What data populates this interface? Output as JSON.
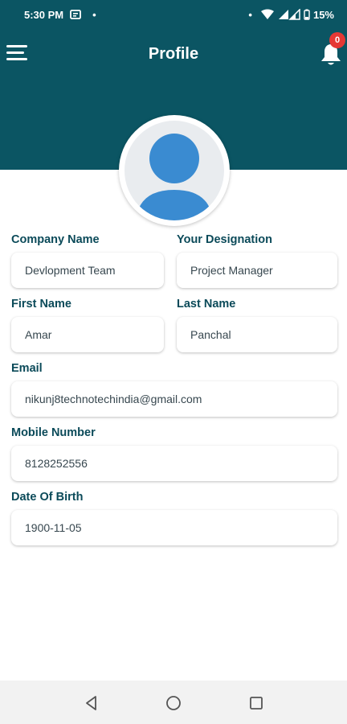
{
  "status_bar": {
    "time": "5:30 PM",
    "dot": "•",
    "battery": "15%",
    "icons": [
      "message-icon",
      "wifi-icon",
      "signal-icon",
      "battery-icon"
    ]
  },
  "header": {
    "title": "Profile",
    "notification_count": "0",
    "icons": [
      "menu-icon",
      "bell-icon"
    ]
  },
  "form": {
    "company": {
      "label": "Company Name",
      "value": "Devlopment Team"
    },
    "designation": {
      "label": "Your Designation",
      "value": "Project Manager"
    },
    "first_name": {
      "label": "First Name",
      "value": "Amar"
    },
    "last_name": {
      "label": "Last Name",
      "value": "Panchal"
    },
    "email": {
      "label": "Email",
      "value": "nikunj8technotechindia@gmail.com"
    },
    "mobile": {
      "label": "Mobile Number",
      "value": "8128252556"
    },
    "dob": {
      "label": "Date Of Birth",
      "value": "1900-11-05"
    }
  },
  "nav": {
    "icons": [
      "back-icon",
      "home-icon",
      "recents-icon"
    ]
  },
  "colors": {
    "primary": "#0b5563",
    "label": "#0b4a59",
    "avatar": "#3a8bd1",
    "badge": "#e53935"
  }
}
